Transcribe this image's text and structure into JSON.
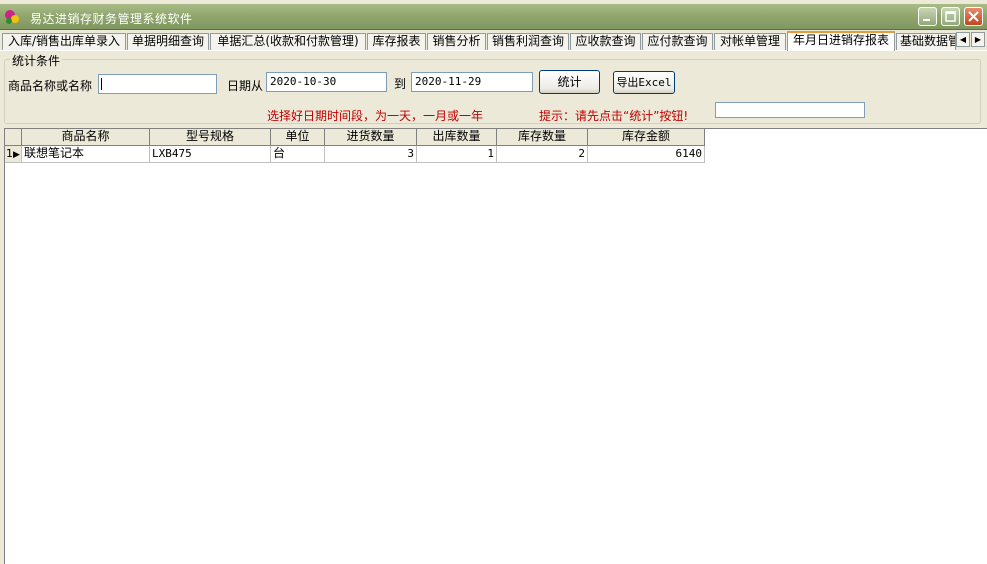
{
  "window": {
    "title": "易达进销存财务管理系统软件",
    "accent": "#8fa56c"
  },
  "tabs": [
    {
      "label": "入库/销售出库单录入"
    },
    {
      "label": "单据明细查询"
    },
    {
      "label": "单据汇总(收款和付款管理)"
    },
    {
      "label": "库存报表"
    },
    {
      "label": "销售分析"
    },
    {
      "label": "销售利润查询"
    },
    {
      "label": "应收款查询"
    },
    {
      "label": "应付款查询"
    },
    {
      "label": "对帐单管理"
    },
    {
      "label": "年月日进销存报表",
      "active": true
    },
    {
      "label": "基础数据管"
    }
  ],
  "conditions": {
    "group_title": "统计条件",
    "product_label": "商品名称或名称",
    "product_value": "",
    "date_from_label": "日期从",
    "date_from": "2020-10-30",
    "to_label": "到",
    "date_to": "2020-11-29",
    "stat_button": "统计",
    "export_button": "导出Excel",
    "hint_range": "选择好日期时间段，为一天，一月或一年",
    "hint_click": "提示：请先点击“统计”按钮!",
    "extra_value": ""
  },
  "grid": {
    "columns": [
      "商品名称",
      "型号规格",
      "单位",
      "进货数量",
      "出库数量",
      "库存数量",
      "库存金额"
    ],
    "rows": [
      {
        "index": "1",
        "name": "联想笔记本",
        "model": "LXB475",
        "unit": "台",
        "in_qty": "3",
        "out_qty": "1",
        "stock_qty": "2",
        "stock_amount": "6140"
      }
    ]
  }
}
